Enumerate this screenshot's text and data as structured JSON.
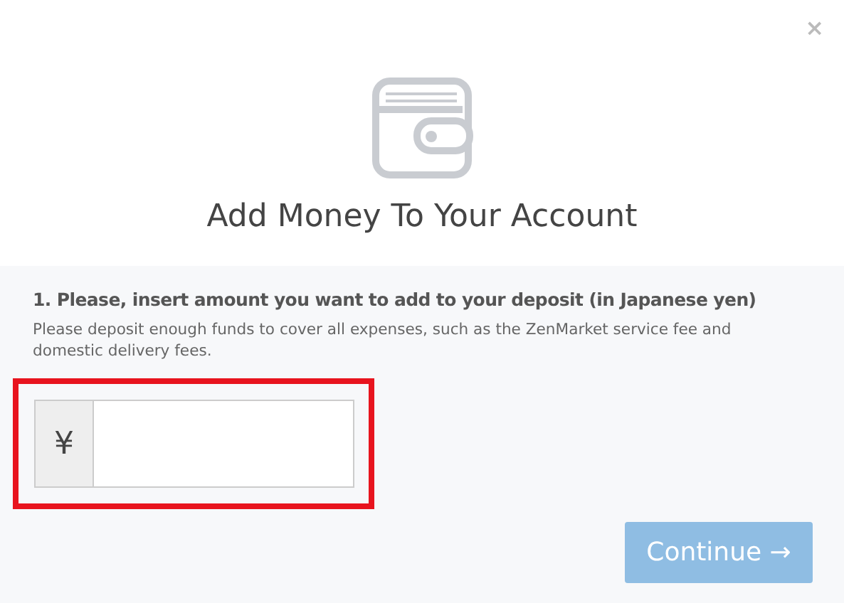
{
  "dialog": {
    "close": "×",
    "title": "Add Money To Your Account"
  },
  "form": {
    "label": "1. Please, insert amount you want to add to your deposit (in Japanese yen)",
    "hint": "Please deposit enough funds to cover all expenses, such as the ZenMarket service fee and domestic delivery fees.",
    "currency": "¥",
    "highlighted": true
  },
  "continue_button": {
    "label": "Continue →",
    "disabled": true
  }
}
